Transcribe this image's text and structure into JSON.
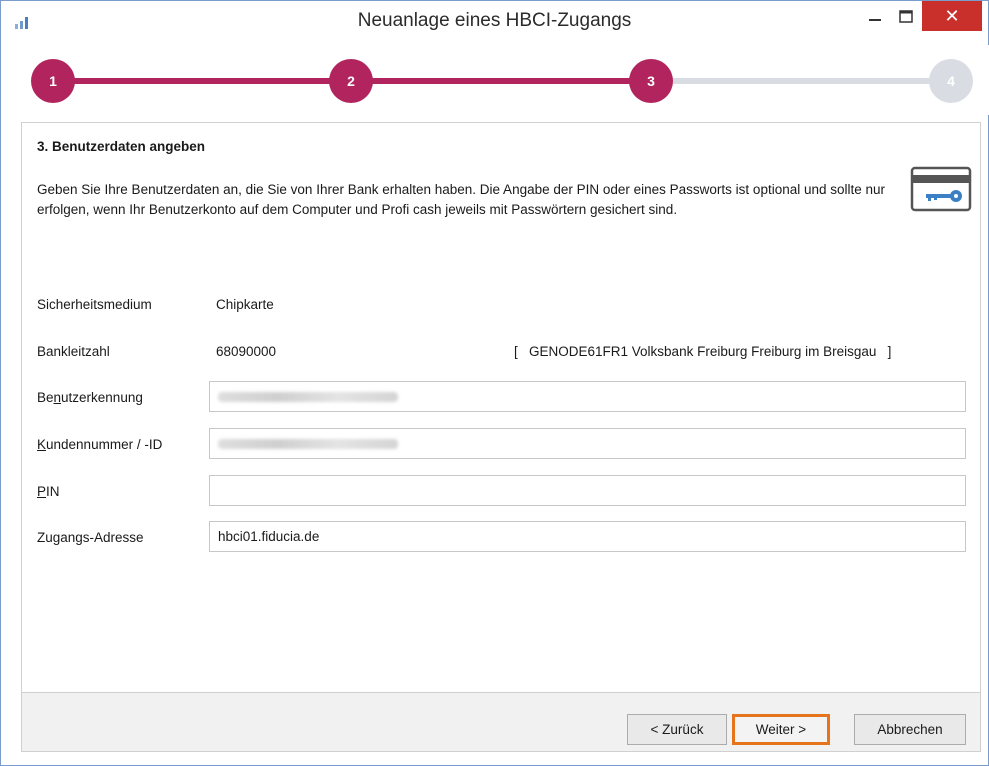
{
  "window": {
    "title": "Neuanlage eines HBCI-Zugangs",
    "close_symbol": "✕",
    "icons": [
      "app-bar-chart-icon",
      "minimize-icon",
      "maximize-icon",
      "close-icon"
    ]
  },
  "stepper": {
    "steps": [
      {
        "label": "1",
        "state": "active"
      },
      {
        "label": "2",
        "state": "active"
      },
      {
        "label": "3",
        "state": "active"
      },
      {
        "label": "4",
        "state": "inactive"
      }
    ],
    "colors": {
      "active": "#b1245e",
      "inactive": "#d9dde3"
    }
  },
  "section": {
    "heading": "3. Benutzerdaten angeben",
    "description": "Geben Sie Ihre Benutzerdaten an, die Sie von Ihrer Bank erhalten haben. Die Angabe der PIN oder eines Passworts ist optional und sollte nur erfolgen, wenn Ihr Benutzerkonto auf dem Computer und Profi cash jeweils mit Passwörtern gesichert sind.",
    "icon": "key-card-icon"
  },
  "form": {
    "security_medium": {
      "label": "Sicherheitsmedium",
      "value": "Chipkarte"
    },
    "bank_code": {
      "label": "Bankleitzahl",
      "value": "68090000",
      "bank_info": "[   GENODE61FR1 Volksbank Freiburg Freiburg im Breisgau   ]"
    },
    "user_id": {
      "label_pre": "Be",
      "label_ul": "n",
      "label_post": "utzerkennung",
      "value": ""
    },
    "customer_id": {
      "label_pre": "",
      "label_ul": "K",
      "label_post": "undennummer / -ID",
      "value": ""
    },
    "pin": {
      "label_pre": "",
      "label_ul": "P",
      "label_post": "IN",
      "value": ""
    },
    "access_address": {
      "label": "Zugangs-Adresse",
      "value": "hbci01.fiducia.de"
    }
  },
  "footer": {
    "back_label": "< Zurück",
    "next_label": "Weiter >",
    "cancel_label": "Abbrechen",
    "highlight_color": "#e6741c"
  }
}
